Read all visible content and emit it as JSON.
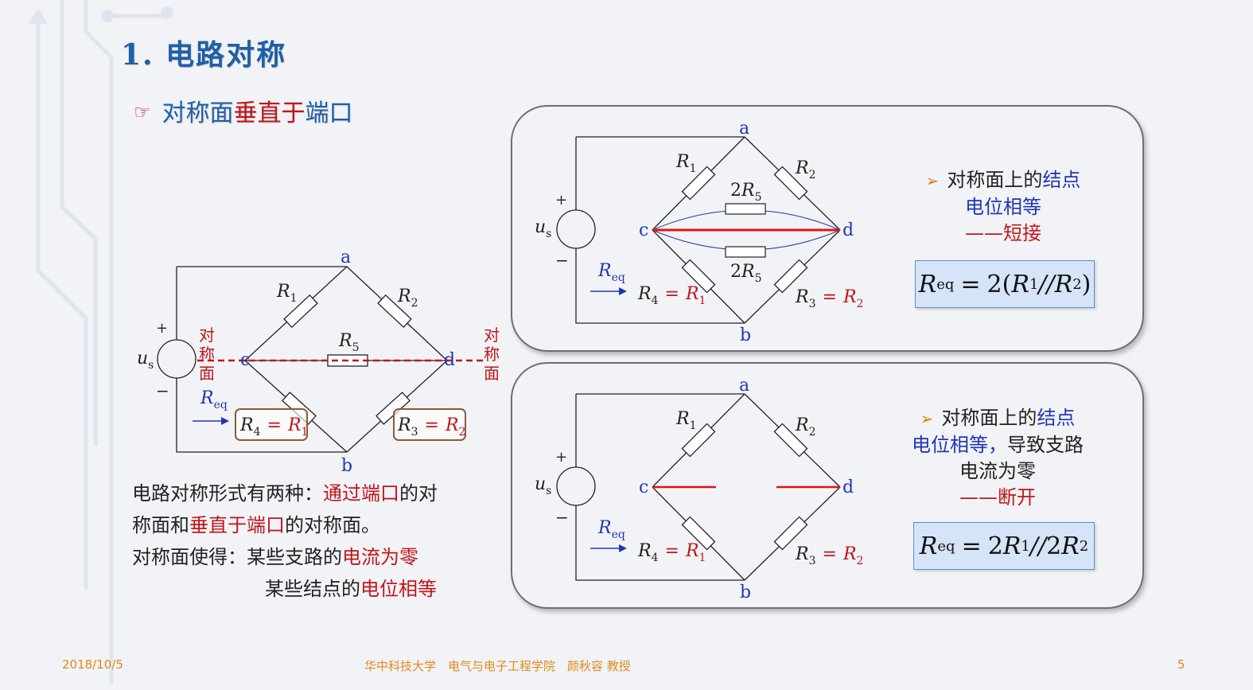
{
  "title": "1. 电路对称",
  "subtitle": {
    "bullet_icon": "pointing-hand-icon",
    "part1": "对称面",
    "part2": "垂直于",
    "part3": "端口"
  },
  "left_circuit": {
    "nodes": {
      "a": "a",
      "b": "b",
      "c": "c",
      "d": "d"
    },
    "plus": "+",
    "minus": "−",
    "source_main": "u",
    "source_sub": "s",
    "r1_main": "R",
    "r1_sub": "1",
    "r2_main": "R",
    "r2_sub": "2",
    "r5_main": "R",
    "r5_sub": "5",
    "req_main": "R",
    "req_sub": "eq",
    "sym_label_chars": [
      "对",
      "称",
      "面"
    ],
    "box1": {
      "lhs_main": "R",
      "lhs_sub": "4",
      "eq": "=",
      "rhs_main": "R",
      "rhs_sub": "1"
    },
    "box2": {
      "lhs_main": "R",
      "lhs_sub": "3",
      "eq": "=",
      "rhs_main": "R",
      "rhs_sub": "2"
    }
  },
  "text_block": {
    "line1_a": "电路对称形式有两种：",
    "line1_b": "通过端口",
    "line1_c": "的对",
    "line2_a": "称面和",
    "line2_b": "垂直于端口",
    "line2_c": "的对称面。",
    "line3_a": "对称面使得：某些支路的",
    "line3_b": "电流为零",
    "line4_a": "某些结点的",
    "line4_b": "电位相等"
  },
  "top_panel": {
    "nodes": {
      "a": "a",
      "b": "b",
      "c": "c",
      "d": "d"
    },
    "plus": "+",
    "minus": "−",
    "source_main": "u",
    "source_sub": "s",
    "r1_main": "R",
    "r1_sub": "1",
    "r2_main": "R",
    "r2_sub": "2",
    "r5_coef": "2",
    "r5_main": "R",
    "r5_sub": "5",
    "req_main": "R",
    "req_sub": "eq",
    "r4_main": "R",
    "r4_sub": "4",
    "eq": "=",
    "r4_rhs_main": "R",
    "r4_rhs_sub": "1",
    "r3_main": "R",
    "r3_sub": "3",
    "r3_rhs_main": "R",
    "r3_rhs_sub": "2",
    "note_bullet_icon": "arrowhead-bullet-icon",
    "note_line1_a": "对称面上的",
    "note_line1_b": "结点",
    "note_line2": "电位相等",
    "note_line3": "——短接",
    "formula": {
      "lhs_main": "R",
      "lhs_sub": "eq",
      "eq": "=",
      "coef": "2(",
      "a_main": "R",
      "a_sub": "1",
      "par": "//",
      "b_main": "R",
      "b_sub": "2",
      "close": ")"
    }
  },
  "bottom_panel": {
    "nodes": {
      "a": "a",
      "b": "b",
      "c": "c",
      "d": "d"
    },
    "plus": "+",
    "minus": "−",
    "source_main": "u",
    "source_sub": "s",
    "r1_main": "R",
    "r1_sub": "1",
    "r2_main": "R",
    "r2_sub": "2",
    "req_main": "R",
    "req_sub": "eq",
    "r4_main": "R",
    "r4_sub": "4",
    "eq": "=",
    "r4_rhs_main": "R",
    "r4_rhs_sub": "1",
    "r3_main": "R",
    "r3_sub": "3",
    "r3_rhs_main": "R",
    "r3_rhs_sub": "2",
    "note_bullet_icon": "arrowhead-bullet-icon",
    "note_line1_a": "对称面上的",
    "note_line1_b": "结点",
    "note_line2_a": "电位相等，",
    "note_line2_b": "导致支路",
    "note_line3": "电流为零",
    "note_line4": "——断开",
    "formula": {
      "lhs_main": "R",
      "lhs_sub": "eq",
      "eq": "=",
      "coef_a": "2",
      "a_main": "R",
      "a_sub": "1",
      "par": "//",
      "coef_b": "2",
      "b_main": "R",
      "b_sub": "2"
    }
  },
  "footer": {
    "date": "2018/10/5",
    "center": "华中科技大学　电气与电子工程学院　颜秋容 教授",
    "page": "5"
  },
  "colors": {
    "title_blue": "#1f5fa6",
    "accent_red": "#c0161b",
    "label_blue": "#1f37b5",
    "footer_orange": "#e08a1a",
    "formula_bg": "#d5e4f6"
  }
}
